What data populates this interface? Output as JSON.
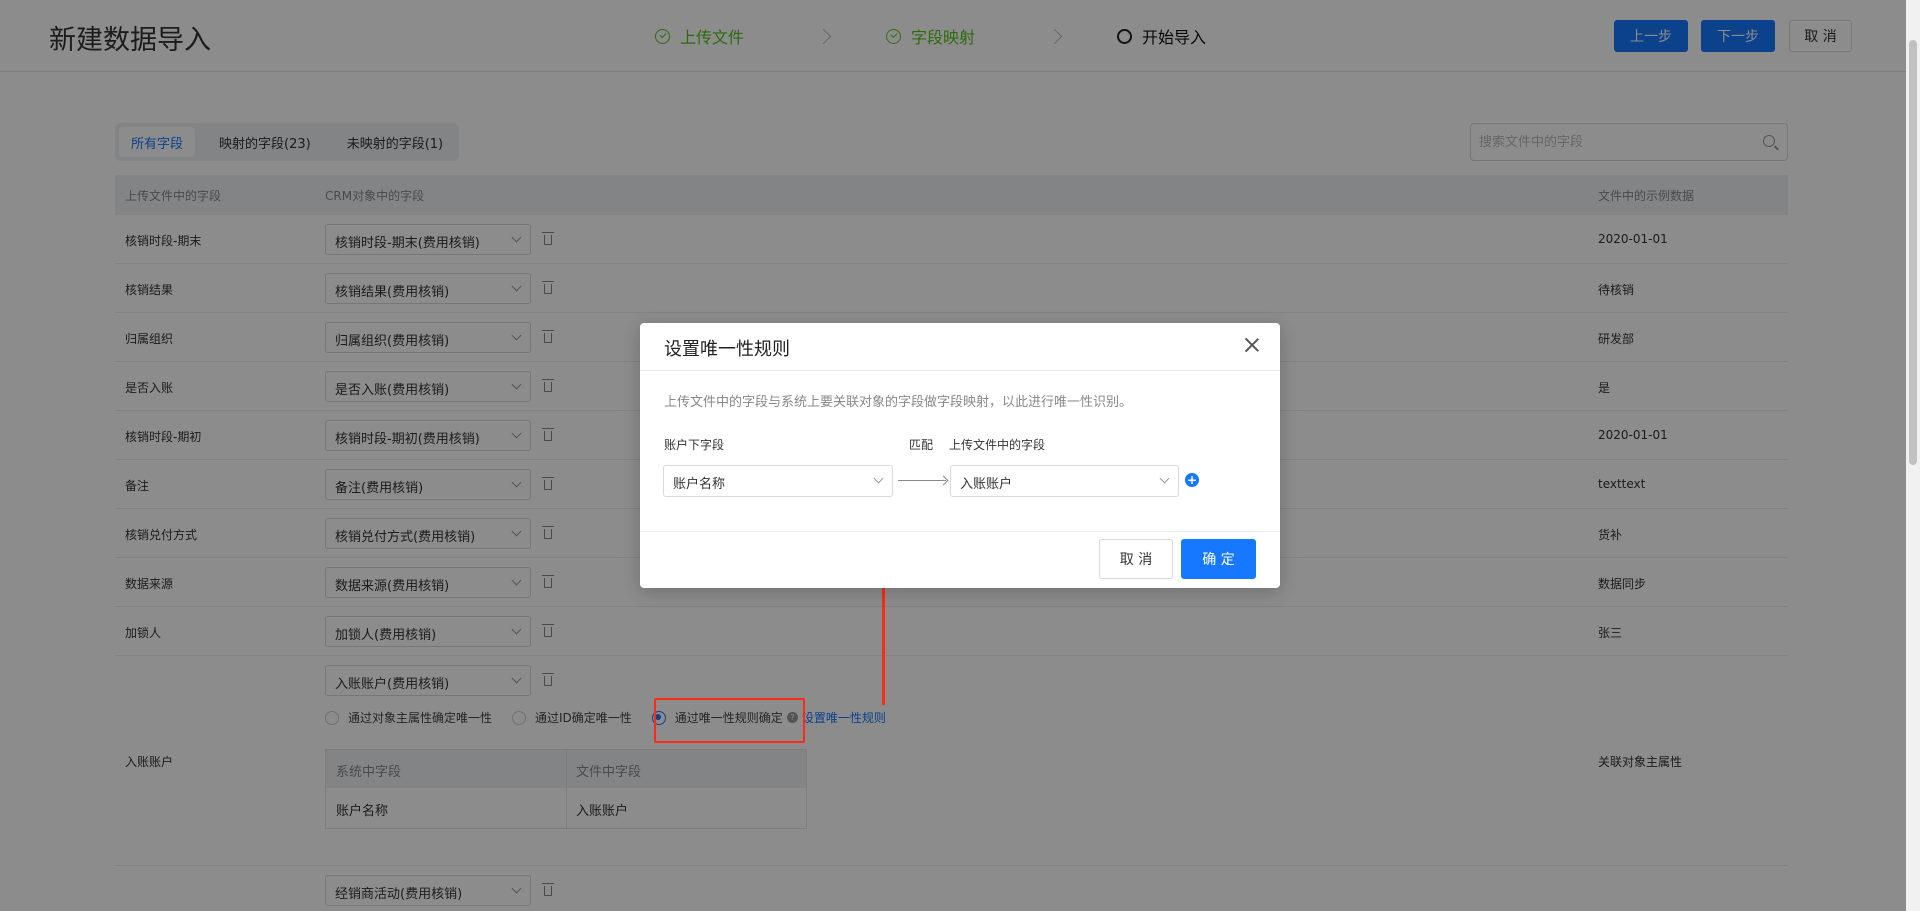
{
  "header": {
    "title": "新建数据导入",
    "steps": [
      {
        "label": "上传文件",
        "state": "done"
      },
      {
        "label": "字段映射",
        "state": "done"
      },
      {
        "label": "开始导入",
        "state": "current"
      }
    ],
    "prev_label": "上一步",
    "next_label": "下一步",
    "cancel_label": "取 消"
  },
  "tabs": [
    {
      "label": "所有字段",
      "active": true
    },
    {
      "label": "映射的字段(23)",
      "active": false
    },
    {
      "label": "未映射的字段(1)",
      "active": false
    }
  ],
  "search": {
    "placeholder": "搜索文件中的字段"
  },
  "table": {
    "headers": [
      "上传文件中的字段",
      "CRM对象中的字段",
      "文件中的示例数据"
    ],
    "rows": [
      {
        "file_field": "核销时段-期末",
        "crm_field": "核销时段-期末(费用核销)",
        "sample": "2020-01-01"
      },
      {
        "file_field": "核销结果",
        "crm_field": "核销结果(费用核销)",
        "sample": "待核销"
      },
      {
        "file_field": "归属组织",
        "crm_field": "归属组织(费用核销)",
        "sample": "研发部"
      },
      {
        "file_field": "是否入账",
        "crm_field": "是否入账(费用核销)",
        "sample": "是"
      },
      {
        "file_field": "核销时段-期初",
        "crm_field": "核销时段-期初(费用核销)",
        "sample": "2020-01-01"
      },
      {
        "file_field": "备注",
        "crm_field": "备注(费用核销)",
        "sample": "texttext"
      },
      {
        "file_field": "核销兑付方式",
        "crm_field": "核销兑付方式(费用核销)",
        "sample": "货补"
      },
      {
        "file_field": "数据来源",
        "crm_field": "数据来源(费用核销)",
        "sample": "数据同步"
      },
      {
        "file_field": "加锁人",
        "crm_field": "加锁人(费用核销)",
        "sample": "张三"
      }
    ],
    "big_row": {
      "file_field": "入账账户",
      "crm_field": "入账账户(费用核销)",
      "sample": "关联对象主属性",
      "radio_options": [
        {
          "label": "通过对象主属性确定唯一性",
          "checked": false
        },
        {
          "label": "通过ID确定唯一性",
          "checked": false
        },
        {
          "label": "通过唯一性规则确定",
          "checked": true
        }
      ],
      "rule_link": "设置唯一性规则",
      "sub_headers": [
        "系统中字段",
        "文件中字段"
      ],
      "sub_row": [
        "账户名称",
        "入账账户"
      ]
    },
    "last_row": {
      "crm_field": "经销商活动(费用核销)"
    }
  },
  "modal": {
    "title": "设置唯一性规则",
    "description": "上传文件中的字段与系统上要关联对象的字段做字段映射，以此进行唯一性识别。",
    "left_label": "账户下字段",
    "match_label": "匹配",
    "right_label": "上传文件中的字段",
    "left_value": "账户名称",
    "right_value": "入账账户",
    "cancel_label": "取 消",
    "ok_label": "确 定"
  },
  "colors": {
    "primary": "#1677ff",
    "success": "#52c41a",
    "annotation": "#ff2a1a"
  }
}
